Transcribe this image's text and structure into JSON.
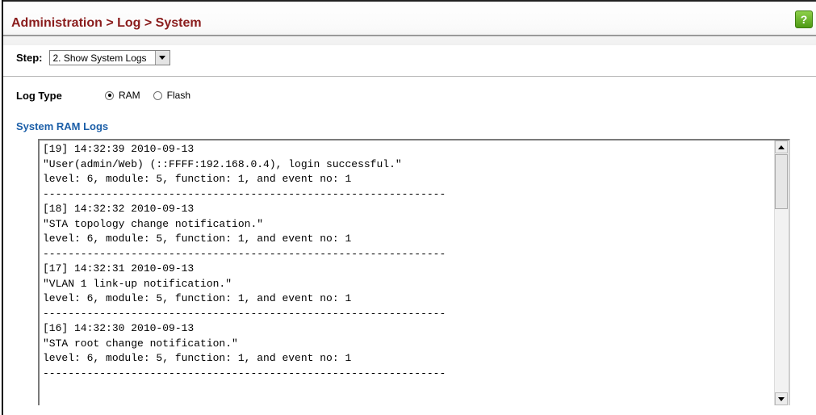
{
  "header": {
    "title": "Administration > Log > System",
    "help_glyph": "?"
  },
  "step": {
    "label": "Step:",
    "selected": "2. Show System Logs"
  },
  "log_type": {
    "label": "Log Type",
    "options": [
      {
        "label": "RAM",
        "checked": true
      },
      {
        "label": "Flash",
        "checked": false
      }
    ]
  },
  "section": {
    "title": "System RAM Logs"
  },
  "log_lines": [
    "[19] 14:32:39 2010-09-13",
    "\"User(admin/Web) (::FFFF:192.168.0.4), login successful.\"",
    "level: 6, module: 5, function: 1, and event no: 1",
    "----------------------------------------------------------------",
    "[18] 14:32:32 2010-09-13",
    "\"STA topology change notification.\"",
    "level: 6, module: 5, function: 1, and event no: 1",
    "----------------------------------------------------------------",
    "[17] 14:32:31 2010-09-13",
    "\"VLAN 1 link-up notification.\"",
    "level: 6, module: 5, function: 1, and event no: 1",
    "----------------------------------------------------------------",
    "[16] 14:32:30 2010-09-13",
    "\"STA root change notification.\"",
    "level: 6, module: 5, function: 1, and event no: 1",
    "----------------------------------------------------------------"
  ],
  "icons": {
    "help": "help-icon",
    "dropdown": "chevron-down-icon",
    "scroll_up": "scroll-up-arrow-icon",
    "scroll_down": "scroll-down-arrow-icon"
  },
  "colors": {
    "title": "#8a1c1c",
    "section_title": "#1c5fa8",
    "help_bg": "#6cb52f"
  }
}
